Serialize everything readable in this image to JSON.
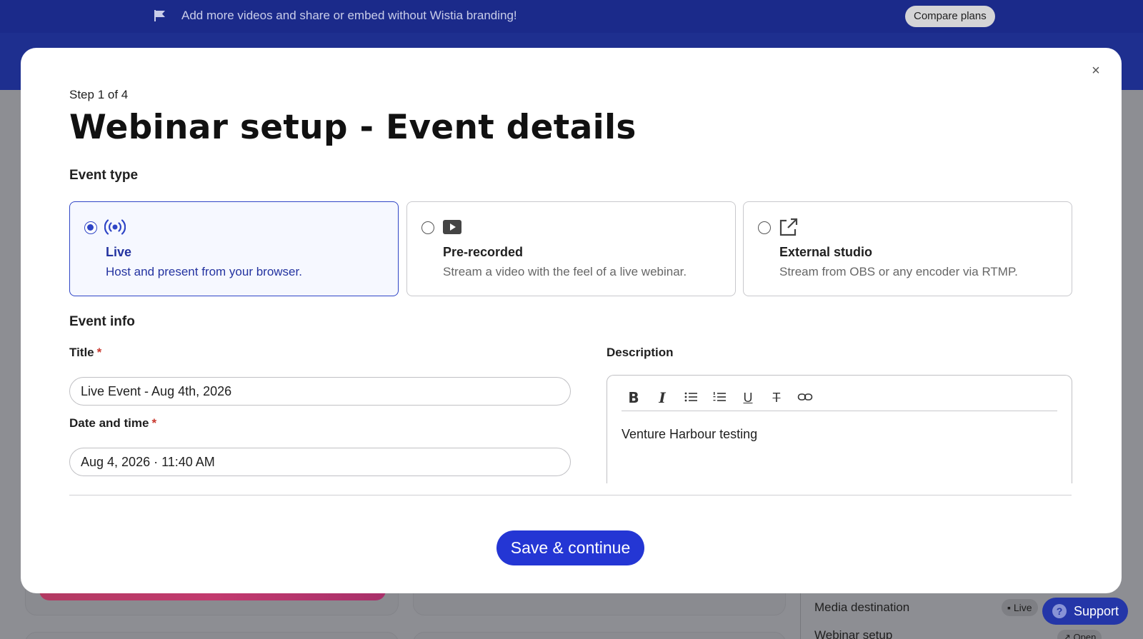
{
  "banner": {
    "icon": "flag-icon",
    "message": "Add more videos and share or embed without Wistia branding!",
    "cta": "Compare plans"
  },
  "background": {
    "side_rows": [
      "Media destination",
      "Webinar setup"
    ],
    "tags": [
      "Live",
      "Open"
    ]
  },
  "support": {
    "label": "Support",
    "icon": "?"
  },
  "modal": {
    "close_icon": "×",
    "step": "Step 1 of 4",
    "title": "Webinar setup - Event details",
    "event_type_heading": "Event type",
    "event_types": [
      {
        "name": "Live",
        "description": "Host and present from your browser.",
        "icon": "broadcast-icon",
        "selected": true
      },
      {
        "name": "Pre-recorded",
        "description": "Stream a video with the feel of a live webinar.",
        "icon": "video-play-icon",
        "selected": false
      },
      {
        "name": "External studio",
        "description": "Stream from OBS or any encoder via RTMP.",
        "icon": "external-link-icon",
        "selected": false
      }
    ],
    "event_info_heading": "Event info",
    "title_label": "Title",
    "title_value": "Live Event - Aug 4th, 2026",
    "datetime_label": "Date and time",
    "datetime_value": "Aug 4, 2026 · 11:40 AM",
    "required_mark": "*",
    "description_label": "Description",
    "description_toolbar": [
      "bold",
      "italic",
      "bulleted-list",
      "numbered-list",
      "underline",
      "strikethrough",
      "link"
    ],
    "description_value": "Venture Harbour testing",
    "save_button": "Save & continue"
  },
  "colors": {
    "banner_bg": "#1b2a8a",
    "primary": "#2436d4",
    "selected_border": "#2f45c6",
    "required": "#c8382e"
  }
}
